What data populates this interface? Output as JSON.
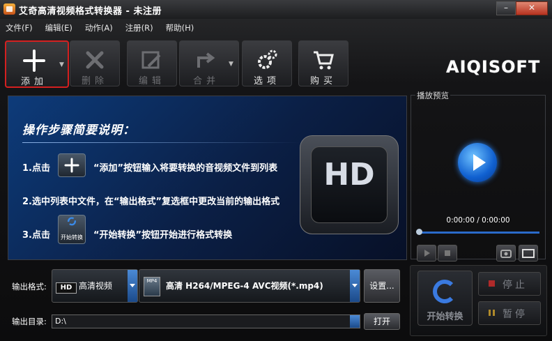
{
  "window": {
    "title": "艾奇高清视频格式转换器 - 未注册"
  },
  "menu": [
    "文件(F)",
    "编辑(E)",
    "动作(A)",
    "注册(R)",
    "帮助(H)"
  ],
  "toolbar": {
    "add": "添加",
    "delete": "删除",
    "edit": "编辑",
    "merge": "合并",
    "options": "选项",
    "buy": "购买"
  },
  "logo": "AIQISOFT",
  "guide": {
    "heading": "操作步骤简要说明：",
    "step1_pre": "1.点击",
    "step1_post": "“添加”按钮输入将要转换的音视频文件到列表",
    "step2": "2.选中列表中文件，在“输出格式”复选框中更改当前的输出格式",
    "step3_pre": "3.点击",
    "step3_post": "“开始转换”按钮开始进行格式转换",
    "step3_icon_label": "开始转换",
    "hd_badge": "HD"
  },
  "preview": {
    "title": "播放预览",
    "time": "0:00:00 / 0:00:00"
  },
  "output": {
    "format_label": "输出格式:",
    "category": "高清视频",
    "category_badge": "HD",
    "format": "高清 H264/MPEG-4 AVC视频(*.mp4)",
    "format_badge": "MP4",
    "settings_button": "设置...",
    "dir_label": "输出目录:",
    "dir_value": "D:\\",
    "open_button": "打开"
  },
  "convert": {
    "start": "开始转换",
    "stop": "停止",
    "pause": "暂停"
  },
  "colors": {
    "accent": "#1f6fd6",
    "highlight": "#d42020"
  }
}
